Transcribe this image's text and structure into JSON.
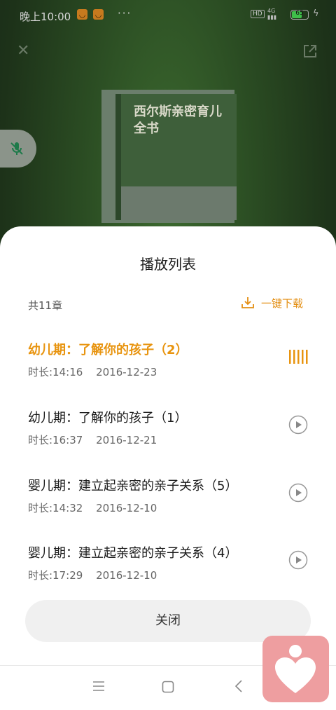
{
  "status_bar": {
    "time": "晚上10:00",
    "more": "···",
    "hd_label": "HD",
    "signal_label": "4G",
    "battery_level": "65"
  },
  "book": {
    "title": "西尔斯亲密育儿全书"
  },
  "playlist": {
    "title": "播放列表",
    "count": "共11章",
    "download_label": "一键下载",
    "items": [
      {
        "title": "幼儿期：了解你的孩子（2）",
        "duration": "时长:14:16",
        "date": "2016-12-23",
        "playing": true
      },
      {
        "title": "幼儿期：了解你的孩子（1）",
        "duration": "时长:16:37",
        "date": "2016-12-21",
        "playing": false
      },
      {
        "title": "婴儿期：建立起亲密的亲子关系（5）",
        "duration": "时长:14:32",
        "date": "2016-12-10",
        "playing": false
      },
      {
        "title": "婴儿期：建立起亲密的亲子关系（4）",
        "duration": "时长:17:29",
        "date": "2016-12-10",
        "playing": false
      }
    ],
    "close_label": "关闭"
  },
  "colors": {
    "accent": "#e8940f",
    "sheet": "#ffffff",
    "close_button_bg": "#f0f0f0"
  }
}
